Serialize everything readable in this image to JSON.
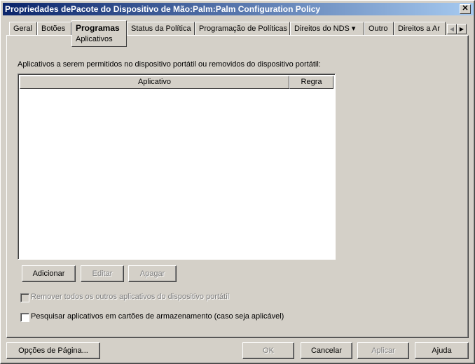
{
  "window": {
    "title": "Propriedades dePacote do Dispositivo de Mão:Palm:Palm Configuration Policy",
    "close": "✕"
  },
  "tabs": [
    {
      "label": "Geral"
    },
    {
      "label": "Botões"
    },
    {
      "label": "Programas",
      "sublabel": "Aplicativos"
    },
    {
      "label": "Status da Política"
    },
    {
      "label": "Programação de Políticas"
    },
    {
      "label": "Direitos do NDS ▾"
    },
    {
      "label": "Outro"
    },
    {
      "label": "Direitos a Ar"
    }
  ],
  "tab_scroll": {
    "left": "◀",
    "right": "▶"
  },
  "main": {
    "list_label": "Aplicativos a serem permitidos no dispositivo portátil ou removidos do dispositivo portátil:",
    "columns": [
      "Aplicativo",
      "Regra"
    ],
    "buttons": {
      "add": "Adicionar",
      "edit": "Editar",
      "delete": "Apagar"
    },
    "checkboxes": [
      {
        "label": "Remover todos os outros aplicativos do dispositivo portátil",
        "checked": false,
        "enabled": false
      },
      {
        "label": "Pesquisar aplicativos em cartões de armazenamento (caso seja aplicável)",
        "checked": false,
        "enabled": true
      }
    ]
  },
  "footer": {
    "page_options": "Opções de Página...",
    "ok": "OK",
    "cancel": "Cancelar",
    "apply": "Aplicar",
    "help": "Ajuda"
  }
}
